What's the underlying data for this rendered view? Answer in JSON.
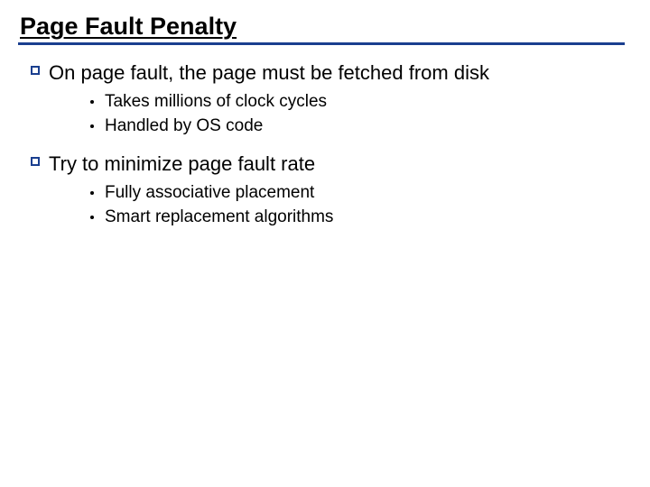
{
  "title": "Page Fault Penalty",
  "bullets": [
    {
      "text": "On page fault, the page must be fetched from disk",
      "sub": [
        "Takes millions of clock cycles",
        "Handled by OS code"
      ]
    },
    {
      "text": "Try to minimize page fault rate",
      "sub": [
        "Fully associative placement",
        "Smart replacement algorithms"
      ]
    }
  ]
}
